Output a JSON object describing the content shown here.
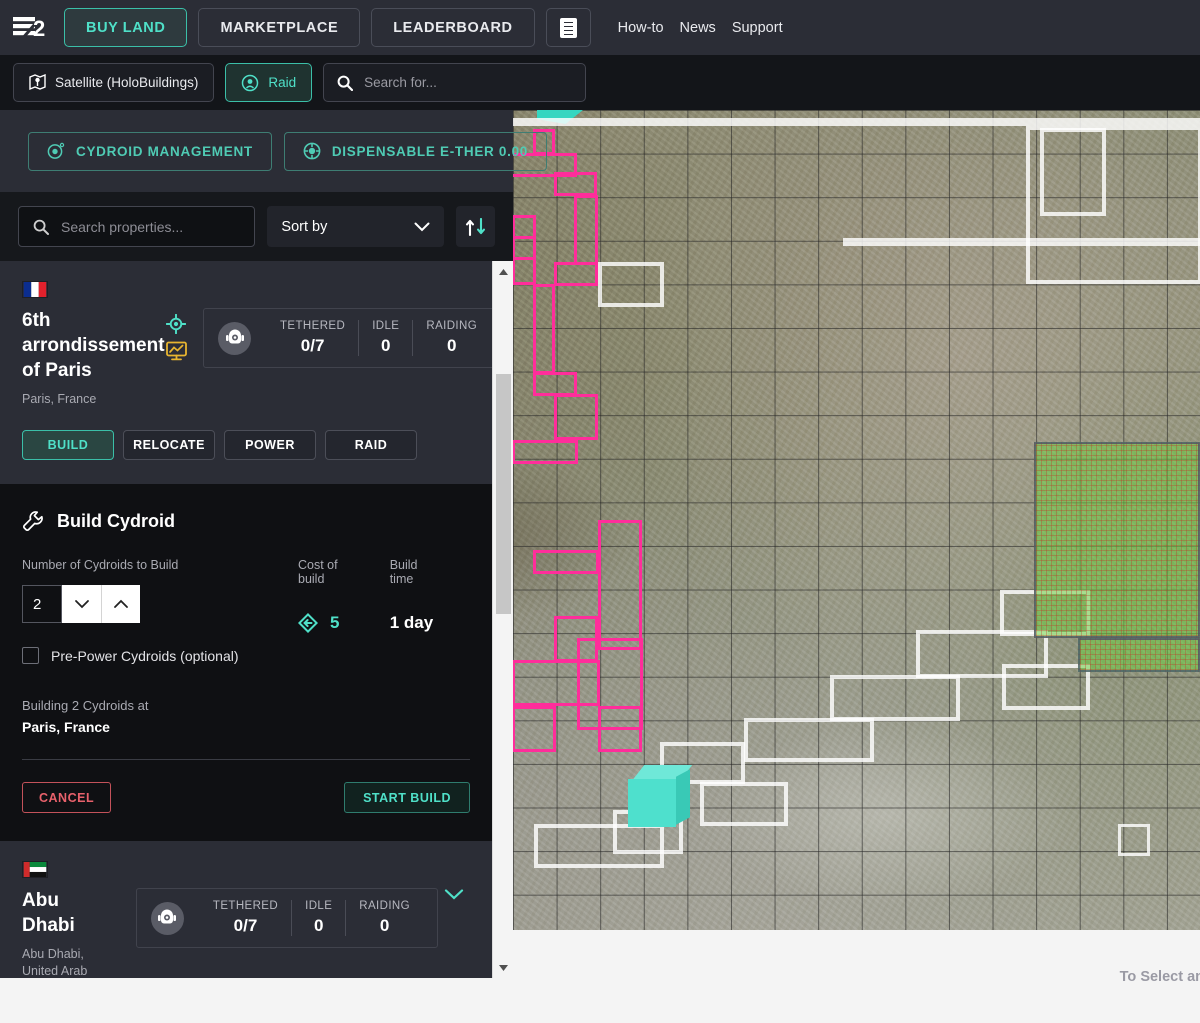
{
  "topnav": {
    "logo_text": "E2",
    "buttons": [
      {
        "label": "BUY LAND",
        "active": true
      },
      {
        "label": "MARKETPLACE",
        "active": false
      },
      {
        "label": "LEADERBOARD",
        "active": false
      }
    ],
    "icon_button": "list-icon",
    "links": [
      "How-to",
      "News",
      "Support"
    ]
  },
  "subbar": {
    "satellite_label": "Satellite (HoloBuildings)",
    "raid_label": "Raid",
    "search_placeholder": "Search for..."
  },
  "panel": {
    "cydroid_management_label": "CYDROID MANAGEMENT",
    "dispensable_ether_label": "DISPENSABLE E-THER 0.00",
    "search_placeholder": "Search properties...",
    "sort_label": "Sort by",
    "sort_toggle": "sort-direction-icon"
  },
  "properties": [
    {
      "flag": "fr",
      "title": "6th arrondissement of Paris",
      "subtitle": "Paris, France",
      "stats": [
        {
          "label": "TETHERED",
          "value": "0/7"
        },
        {
          "label": "IDLE",
          "value": "0"
        },
        {
          "label": "RAIDING",
          "value": "0"
        }
      ],
      "expanded": true,
      "actions": [
        {
          "label": "BUILD",
          "selected": true
        },
        {
          "label": "RELOCATE",
          "selected": false
        },
        {
          "label": "POWER",
          "selected": false
        },
        {
          "label": "RAID",
          "selected": false
        }
      ]
    },
    {
      "flag": "ae",
      "title": "Abu Dhabi",
      "subtitle": "Abu Dhabi, United Arab Emirates",
      "stats": [
        {
          "label": "TETHERED",
          "value": "0/7"
        },
        {
          "label": "IDLE",
          "value": "0"
        },
        {
          "label": "RAIDING",
          "value": "0"
        }
      ],
      "expanded": false
    }
  ],
  "build": {
    "heading": "Build Cydroid",
    "number_label": "Number of Cydroids to Build",
    "number_value": "2",
    "cost_label": "Cost of build",
    "cost_value": "5",
    "time_label": "Build time",
    "time_value": "1 day",
    "prepower_label": "Pre-Power Cydroids (optional)",
    "note_line1": "Building 2 Cydroids at",
    "note_line2": "Paris, France",
    "cancel_label": "CANCEL",
    "start_label": "START BUILD"
  },
  "map": {
    "hint_text": "To Select an"
  },
  "colors": {
    "accent_teal": "#4fe0c8",
    "plot_pink": "#ff2d9b",
    "panel_bg": "#2b2d36",
    "dark_bg": "#0f1013",
    "cancel_red": "#e8616b",
    "green_plot": "#6ed246"
  }
}
